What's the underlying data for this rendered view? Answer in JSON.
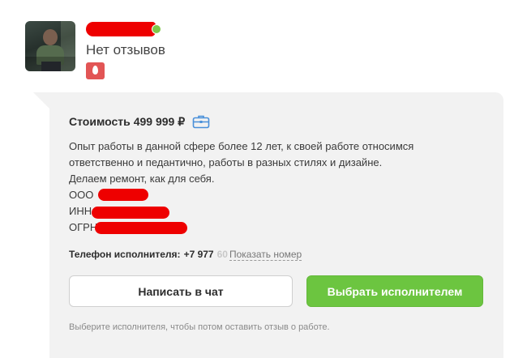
{
  "profile": {
    "reviews_text": "Нет отзывов",
    "online_color": "#7ec84a",
    "badge_icon": "drop-icon",
    "badge_color": "#e25555"
  },
  "offer": {
    "price_label": "Стоимость",
    "price_value": "499 999 ₽",
    "price_icon": "briefcase-icon",
    "description": {
      "line1": "Опыт работы в данной сфере более 12 лет, к своей работе относимся",
      "line2": "ответственно и педантично, работы в разных стилях и дизайне.",
      "line3": "Делаем ремонт, как для себя.",
      "company_prefix": "ООО",
      "inn_prefix": "ИНН",
      "ogrn_prefix": "ОГРН"
    },
    "phone_label": "Телефон исполнителя:",
    "phone_visible": "+7 977",
    "phone_faded": "60",
    "show_phone_link": "Показать номер"
  },
  "actions": {
    "chat_button": "Написать в чат",
    "choose_button": "Выбрать исполнителем",
    "hint": "Выберите исполнителя, чтобы потом оставить отзыв о работе."
  },
  "colors": {
    "accent_green": "#6cc540",
    "card_background": "#f2f2f2",
    "redaction": "#ee0000"
  }
}
